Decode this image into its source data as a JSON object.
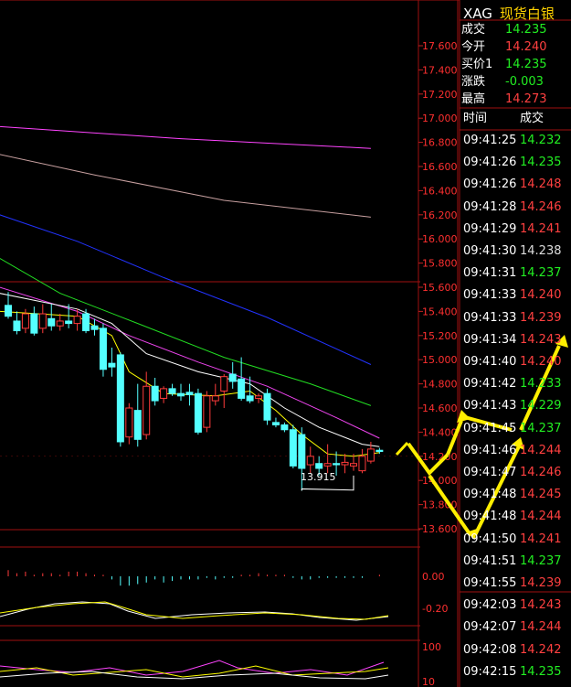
{
  "instrument": {
    "symbol": "XAG",
    "name": "现货白银"
  },
  "quote": [
    {
      "label": "成交",
      "value": "14.235",
      "color": "#22ee22"
    },
    {
      "label": "今开",
      "value": "14.240",
      "color": "#ff4040"
    },
    {
      "label": "买价1",
      "value": "14.235",
      "color": "#22ee22"
    },
    {
      "label": "涨跌",
      "value": "-0.003",
      "color": "#22ee22"
    },
    {
      "label": "最高",
      "value": "14.273",
      "color": "#ff4040"
    }
  ],
  "trades": {
    "headers": [
      "时间",
      "成交"
    ],
    "rows": [
      {
        "time": "09:41:25",
        "price": "14.232",
        "color": "#22ee22"
      },
      {
        "time": "09:41:26",
        "price": "14.235",
        "color": "#22ee22"
      },
      {
        "time": "09:41:26",
        "price": "14.248",
        "color": "#ff4040"
      },
      {
        "time": "09:41:28",
        "price": "14.246",
        "color": "#ff4040"
      },
      {
        "time": "09:41:29",
        "price": "14.241",
        "color": "#ff4040"
      },
      {
        "time": "09:41:30",
        "price": "14.238",
        "color": "#dddddd"
      },
      {
        "time": "09:41:31",
        "price": "14.237",
        "color": "#22ee22"
      },
      {
        "time": "09:41:33",
        "price": "14.240",
        "color": "#ff4040"
      },
      {
        "time": "09:41:33",
        "price": "14.239",
        "color": "#ff4040"
      },
      {
        "time": "09:41:34",
        "price": "14.243",
        "color": "#ff4040"
      },
      {
        "time": "09:41:40",
        "price": "14.240",
        "color": "#ff4040"
      },
      {
        "time": "09:41:42",
        "price": "14.233",
        "color": "#22ee22"
      },
      {
        "time": "09:41:43",
        "price": "14.229",
        "color": "#22ee22"
      },
      {
        "time": "09:41:45",
        "price": "14.237",
        "color": "#22ee22"
      },
      {
        "time": "09:41:46",
        "price": "14.244",
        "color": "#ff4040"
      },
      {
        "time": "09:41:47",
        "price": "14.246",
        "color": "#ff4040"
      },
      {
        "time": "09:41:48",
        "price": "14.245",
        "color": "#ff4040"
      },
      {
        "time": "09:41:48",
        "price": "14.244",
        "color": "#ff4040"
      },
      {
        "time": "09:41:50",
        "price": "14.241",
        "color": "#ff4040"
      },
      {
        "time": "09:41:51",
        "price": "14.237",
        "color": "#22ee22"
      },
      {
        "time": "09:41:55",
        "price": "14.239",
        "color": "#ff4040"
      },
      {
        "time": "09:42:03",
        "price": "14.243",
        "color": "#ff4040"
      },
      {
        "time": "09:42:07",
        "price": "14.244",
        "color": "#ff4040"
      },
      {
        "time": "09:42:08",
        "price": "14.242",
        "color": "#ff4040"
      },
      {
        "time": "09:42:15",
        "price": "14.235",
        "color": "#22ee22"
      }
    ]
  },
  "chart_data": {
    "type": "candlestick",
    "y_ticks": [
      "17.600",
      "17.400",
      "17.200",
      "17.000",
      "16.800",
      "16.600",
      "16.400",
      "16.200",
      "16.000",
      "15.800",
      "15.600",
      "15.400",
      "15.200",
      "15.000",
      "14.800",
      "14.600",
      "14.400",
      "14.200",
      "14.000",
      "13.800",
      "13.600"
    ],
    "ylim": [
      13.6,
      17.6
    ],
    "low_annotation": "13.915",
    "candles": [
      {
        "o": 15.45,
        "h": 15.56,
        "l": 15.34,
        "c": 15.36
      },
      {
        "o": 15.32,
        "h": 15.4,
        "l": 15.21,
        "c": 15.24
      },
      {
        "o": 15.26,
        "h": 15.42,
        "l": 15.22,
        "c": 15.38
      },
      {
        "o": 15.38,
        "h": 15.44,
        "l": 15.2,
        "c": 15.22
      },
      {
        "o": 15.26,
        "h": 15.46,
        "l": 15.22,
        "c": 15.38
      },
      {
        "o": 15.34,
        "h": 15.46,
        "l": 15.24,
        "c": 15.28
      },
      {
        "o": 15.28,
        "h": 15.38,
        "l": 15.24,
        "c": 15.32
      },
      {
        "o": 15.32,
        "h": 15.46,
        "l": 15.26,
        "c": 15.3
      },
      {
        "o": 15.3,
        "h": 15.42,
        "l": 15.24,
        "c": 15.36
      },
      {
        "o": 15.38,
        "h": 15.42,
        "l": 15.22,
        "c": 15.24
      },
      {
        "o": 15.28,
        "h": 15.34,
        "l": 15.2,
        "c": 15.25
      },
      {
        "o": 15.26,
        "h": 15.3,
        "l": 14.86,
        "c": 14.92
      },
      {
        "o": 14.97,
        "h": 15.1,
        "l": 14.86,
        "c": 14.94
      },
      {
        "o": 15.04,
        "h": 15.06,
        "l": 14.28,
        "c": 14.32
      },
      {
        "o": 14.36,
        "h": 14.64,
        "l": 14.3,
        "c": 14.6
      },
      {
        "o": 14.58,
        "h": 14.8,
        "l": 14.28,
        "c": 14.34
      },
      {
        "o": 14.38,
        "h": 14.9,
        "l": 14.34,
        "c": 14.78
      },
      {
        "o": 14.78,
        "h": 14.85,
        "l": 14.62,
        "c": 14.66
      },
      {
        "o": 14.68,
        "h": 14.78,
        "l": 14.64,
        "c": 14.76
      },
      {
        "o": 14.76,
        "h": 14.8,
        "l": 14.7,
        "c": 14.72
      },
      {
        "o": 14.72,
        "h": 14.8,
        "l": 14.66,
        "c": 14.7
      },
      {
        "o": 14.73,
        "h": 14.8,
        "l": 14.62,
        "c": 14.71
      },
      {
        "o": 14.72,
        "h": 14.76,
        "l": 14.38,
        "c": 14.4
      },
      {
        "o": 14.44,
        "h": 14.74,
        "l": 14.4,
        "c": 14.7
      },
      {
        "o": 14.66,
        "h": 14.8,
        "l": 14.62,
        "c": 14.7
      },
      {
        "o": 14.74,
        "h": 14.88,
        "l": 14.6,
        "c": 14.86
      },
      {
        "o": 14.88,
        "h": 14.98,
        "l": 14.76,
        "c": 14.82
      },
      {
        "o": 14.84,
        "h": 15.02,
        "l": 14.66,
        "c": 14.68
      },
      {
        "o": 14.7,
        "h": 14.86,
        "l": 14.64,
        "c": 14.66
      },
      {
        "o": 14.68,
        "h": 14.72,
        "l": 14.64,
        "c": 14.7
      },
      {
        "o": 14.72,
        "h": 14.76,
        "l": 14.46,
        "c": 14.5
      },
      {
        "o": 14.48,
        "h": 14.52,
        "l": 14.44,
        "c": 14.46
      },
      {
        "o": 14.46,
        "h": 14.48,
        "l": 14.4,
        "c": 14.42
      },
      {
        "o": 14.42,
        "h": 14.46,
        "l": 14.1,
        "c": 14.12
      },
      {
        "o": 14.38,
        "h": 14.44,
        "l": 13.915,
        "c": 14.1
      },
      {
        "o": 14.13,
        "h": 14.28,
        "l": 14.06,
        "c": 14.2
      },
      {
        "o": 14.14,
        "h": 14.2,
        "l": 14.04,
        "c": 14.1
      },
      {
        "o": 14.12,
        "h": 14.3,
        "l": 14.06,
        "c": 14.14
      },
      {
        "o": 14.14,
        "h": 14.24,
        "l": 14.04,
        "c": 14.13
      },
      {
        "o": 14.13,
        "h": 14.22,
        "l": 14.06,
        "c": 14.15
      },
      {
        "o": 14.12,
        "h": 14.22,
        "l": 14.08,
        "c": 14.14
      },
      {
        "o": 14.08,
        "h": 14.26,
        "l": 14.06,
        "c": 14.2
      },
      {
        "o": 14.16,
        "h": 14.32,
        "l": 14.14,
        "c": 14.26
      },
      {
        "o": 14.25,
        "h": 14.27,
        "l": 14.22,
        "c": 14.24
      }
    ],
    "moving_averages": [
      {
        "color": "#ff44ff",
        "points": [
          [
            -1,
            16.93
          ],
          [
            20,
            16.83
          ],
          [
            42,
            16.75
          ]
        ]
      },
      {
        "color": "#c8a0a0",
        "points": [
          [
            -1,
            16.7
          ],
          [
            10,
            16.53
          ],
          [
            25,
            16.32
          ],
          [
            42,
            16.18
          ]
        ]
      },
      {
        "color": "#2233ff",
        "points": [
          [
            -1,
            16.2
          ],
          [
            8,
            15.98
          ],
          [
            18,
            15.68
          ],
          [
            30,
            15.35
          ],
          [
            42,
            14.96
          ]
        ]
      },
      {
        "color": "#22dd22",
        "points": [
          [
            -1,
            15.84
          ],
          [
            6,
            15.55
          ],
          [
            15,
            15.3
          ],
          [
            25,
            15.02
          ],
          [
            35,
            14.8
          ],
          [
            42,
            14.62
          ]
        ]
      },
      {
        "color": "#ee44ee",
        "points": [
          [
            -1,
            15.6
          ],
          [
            8,
            15.4
          ],
          [
            14,
            15.2
          ],
          [
            22,
            14.98
          ],
          [
            30,
            14.78
          ],
          [
            38,
            14.52
          ],
          [
            43,
            14.35
          ]
        ]
      },
      {
        "color": "#ffffff",
        "points": [
          [
            -1,
            15.55
          ],
          [
            8,
            15.42
          ],
          [
            12,
            15.3
          ],
          [
            16,
            15.05
          ],
          [
            22,
            14.9
          ],
          [
            28,
            14.8
          ],
          [
            32,
            14.6
          ],
          [
            36,
            14.44
          ],
          [
            41,
            14.3
          ],
          [
            43,
            14.28
          ]
        ]
      },
      {
        "color": "#ffff00",
        "points": [
          [
            -1,
            15.4
          ],
          [
            8,
            15.36
          ],
          [
            12,
            15.2
          ],
          [
            14,
            14.9
          ],
          [
            18,
            14.72
          ],
          [
            24,
            14.7
          ],
          [
            28,
            14.74
          ],
          [
            31,
            14.58
          ],
          [
            34,
            14.38
          ],
          [
            37,
            14.22
          ],
          [
            40,
            14.2
          ],
          [
            43,
            14.23
          ]
        ]
      }
    ],
    "indicator1": {
      "y_ticks": [
        "0.00",
        "-0.20"
      ],
      "bars": [
        0.04,
        0.02,
        0.03,
        0.01,
        0.02,
        0.02,
        0.01,
        0.03,
        0.03,
        0.02,
        0.01,
        0.01,
        -0.02,
        -0.06,
        -0.06,
        -0.05,
        -0.04,
        -0.02,
        -0.04,
        -0.03,
        -0.02,
        -0.02,
        -0.02,
        -0.01,
        -0.02,
        -0.01,
        -0.01,
        0.01,
        0.01,
        0.02,
        0.01,
        0.01,
        0.01,
        -0.01,
        -0.02,
        -0.02,
        -0.01,
        -0.01,
        -0.01,
        -0.01,
        -0.01,
        -0.01,
        0.0,
        0.01
      ]
    },
    "indicator2": {
      "y_ticks": [
        "100",
        "10"
      ]
    }
  }
}
